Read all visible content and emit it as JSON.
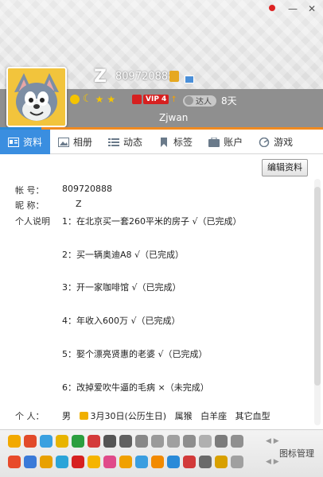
{
  "window": {
    "controls": {
      "minimize": "—",
      "close": "✕"
    }
  },
  "profile": {
    "nickname": "Z",
    "qq_number": "809720888",
    "level_icons": [
      "sun-icon",
      "moon-icon",
      "star-icon",
      "star-icon"
    ],
    "vip": {
      "label": "VIP 4",
      "arrow": "↑"
    },
    "daren": {
      "label": "达人",
      "days": "8天"
    },
    "signature": "Zjwan"
  },
  "tabs": [
    {
      "label": "资料",
      "icon": "profile-card-icon",
      "active": true
    },
    {
      "label": "相册",
      "icon": "photo-icon",
      "active": false
    },
    {
      "label": "动态",
      "icon": "list-icon",
      "active": false
    },
    {
      "label": "标签",
      "icon": "bookmark-icon",
      "active": false
    },
    {
      "label": "账户",
      "icon": "wallet-icon",
      "active": false
    },
    {
      "label": "游戏",
      "icon": "game-icon",
      "active": false
    }
  ],
  "details": {
    "edit_button": "编辑资料",
    "account_label": "帐    号：",
    "account_value": "809720888",
    "nickname_label": "昵    称：",
    "nickname_value": "Z",
    "intro_label": "个人说明",
    "intro_items": [
      "1：在北京买一套260平米的房子 √（已完成）",
      "2：买一辆奥迪A8 √（已完成）",
      "3：开一家咖啡馆 √（已完成）",
      "4：年收入600万 √（已完成）",
      "5：娶个漂亮贤惠的老婆 √（已完成）",
      "6：改掉爱吹牛逼的毛病 ×（未完成）"
    ],
    "person_label": "个    人：",
    "gender": "男",
    "birthday": "3月30日(公历生日)",
    "zodiac": "属猴",
    "constellation": "白羊座",
    "blood_type": "其它血型"
  },
  "footer": {
    "manage_label": "图标管理",
    "arrow_up": "◀ ▶",
    "row1_colors": [
      "#f2a900",
      "#e24a2a",
      "#3aa0e0",
      "#e8b400",
      "#2b9e3f",
      "#d43a3a",
      "#555555",
      "#606060",
      "#888888",
      "#9a9a9a",
      "#a0a0a0",
      "#8e8e8e",
      "#b0b0b0",
      "#7c7c7c",
      "#909090"
    ],
    "row2_colors": [
      "#e84a2a",
      "#3a7ad8",
      "#e8a000",
      "#2ba4d8",
      "#d62020",
      "#f5b400",
      "#e04a8a",
      "#f0a000",
      "#3a9ee0",
      "#f28a00",
      "#2a8ad8",
      "#d23a3a",
      "#6a6a6a",
      "#d8a000",
      "#a0a0a0"
    ]
  }
}
